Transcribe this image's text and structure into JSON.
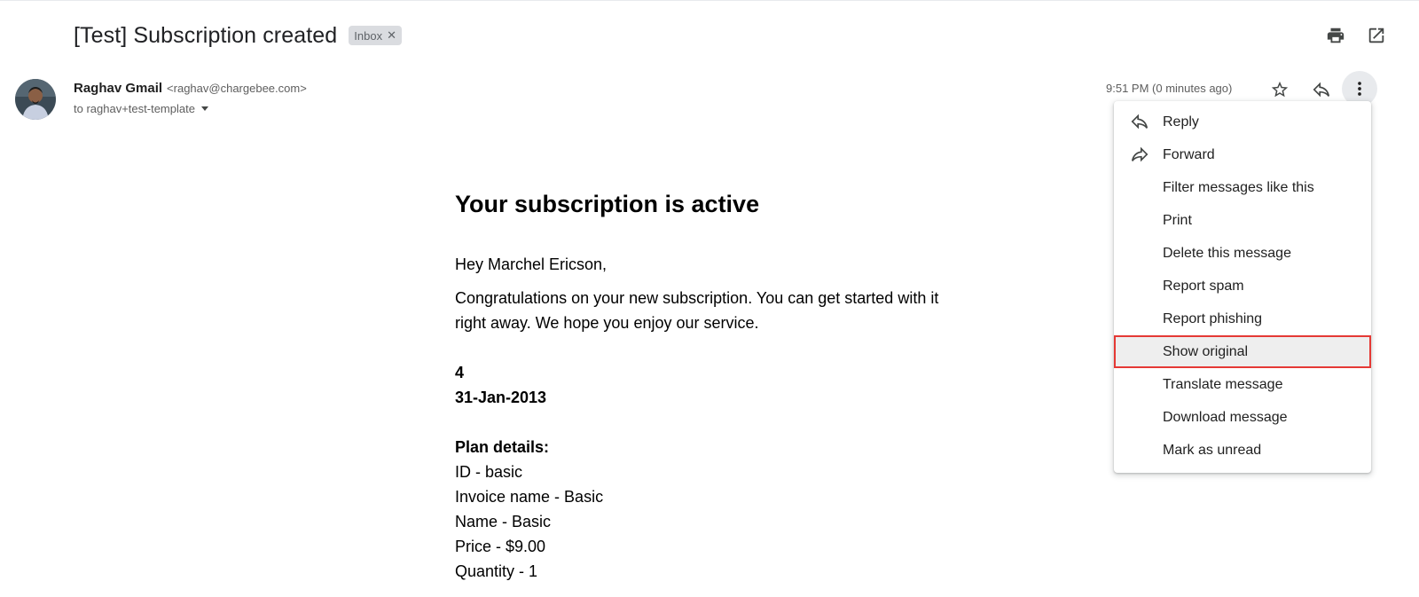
{
  "email": {
    "subject": "[Test] Subscription created",
    "label_chip": "Inbox",
    "sender_name": "Raghav Gmail",
    "sender_email": "<raghav@chargebee.com>",
    "recipient": "to raghav+test-template",
    "time": "9:51 PM (0 minutes ago)"
  },
  "body": {
    "heading": "Your subscription is active",
    "greeting": "Hey Marchel Ericson,",
    "paragraph": "Congratulations on your new subscription. You can get started with it right away. We hope you enjoy our service.",
    "number": "4",
    "date": "31-Jan-2013",
    "plan_heading": "Plan details:",
    "plan_lines": [
      "ID - basic",
      "Invoice name - Basic",
      "Name - Basic",
      "Price - $9.00",
      "Quantity - 1"
    ]
  },
  "menu": {
    "items": [
      {
        "label": "Reply",
        "icon": "reply-icon"
      },
      {
        "label": "Forward",
        "icon": "forward-icon"
      },
      {
        "label": "Filter messages like this"
      },
      {
        "label": "Print"
      },
      {
        "label": "Delete this message"
      },
      {
        "label": "Report spam"
      },
      {
        "label": "Report phishing"
      },
      {
        "label": "Show original",
        "highlighted": true
      },
      {
        "label": "Translate message"
      },
      {
        "label": "Download message"
      },
      {
        "label": "Mark as unread"
      }
    ]
  },
  "icons": {
    "print": "print-icon",
    "open_new_window": "open-in-new-icon",
    "star": "star-icon",
    "reply": "reply-icon",
    "more": "more-vert-icon"
  },
  "colors": {
    "highlight_outline": "#e53935",
    "chip_bg": "#dadce0"
  }
}
